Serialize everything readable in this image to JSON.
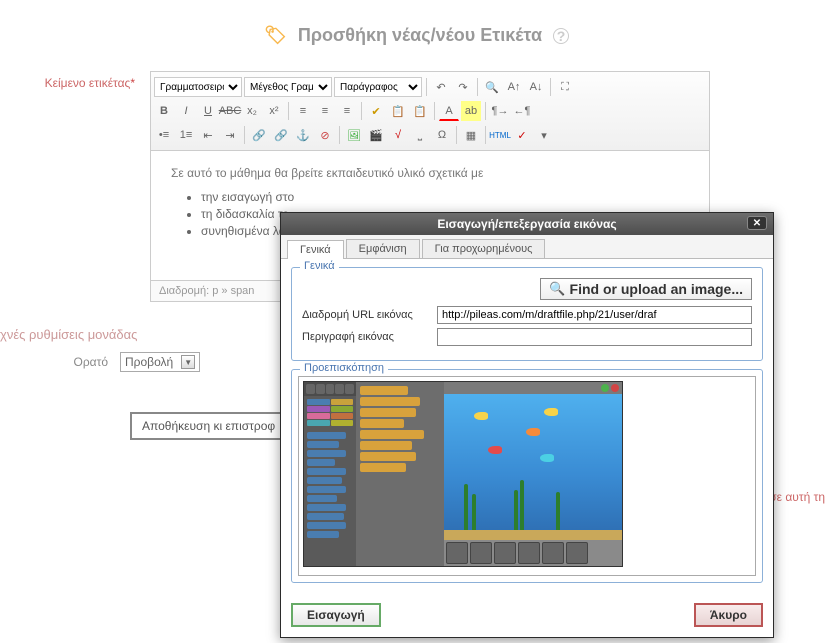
{
  "page": {
    "title": "Προσθήκη νέας/νέου Ετικέτα"
  },
  "form": {
    "text_label": "Κείμενο ετικέτας",
    "required_mark": "*",
    "font_placeholder": "Γραμματοσειρά",
    "size_placeholder": "Μέγεθος Γραμ",
    "format_placeholder": "Παράγραφος",
    "body_intro": "Σε αυτό το μάθημα θα βρείτε εκπαιδευτικό υλικό σχετικά με",
    "body_items": [
      "την εισαγωγή στο",
      "τη διδασκαλία το",
      "συνηθισμένα λάθη"
    ],
    "path": "Διαδρομή: p » span"
  },
  "module": {
    "section": "χνές ρυθμίσεις μονάδας",
    "visible_label": "Ορατό",
    "visible_value": "Προβολή",
    "save_button": "Αποθήκευση κι επιστροφ"
  },
  "footer": {
    "link": "σε αυτή τη"
  },
  "modal": {
    "title": "Εισαγωγή/επεξεργασία εικόνας",
    "tabs": {
      "general": "Γενικά",
      "appearance": "Εμφάνιση",
      "advanced": "Για προχωρημένους"
    },
    "legend_general": "Γενικά",
    "find_button": "Find or upload an image...",
    "url_label": "Διαδρομή URL εικόνας",
    "url_value": "http://pileas.com/m/draftfile.php/21/user/draf",
    "desc_label": "Περιγραφή εικόνας",
    "desc_value": "",
    "legend_preview": "Προεπισκόπηση",
    "insert": "Εισαγωγή",
    "cancel": "Άκυρο"
  }
}
